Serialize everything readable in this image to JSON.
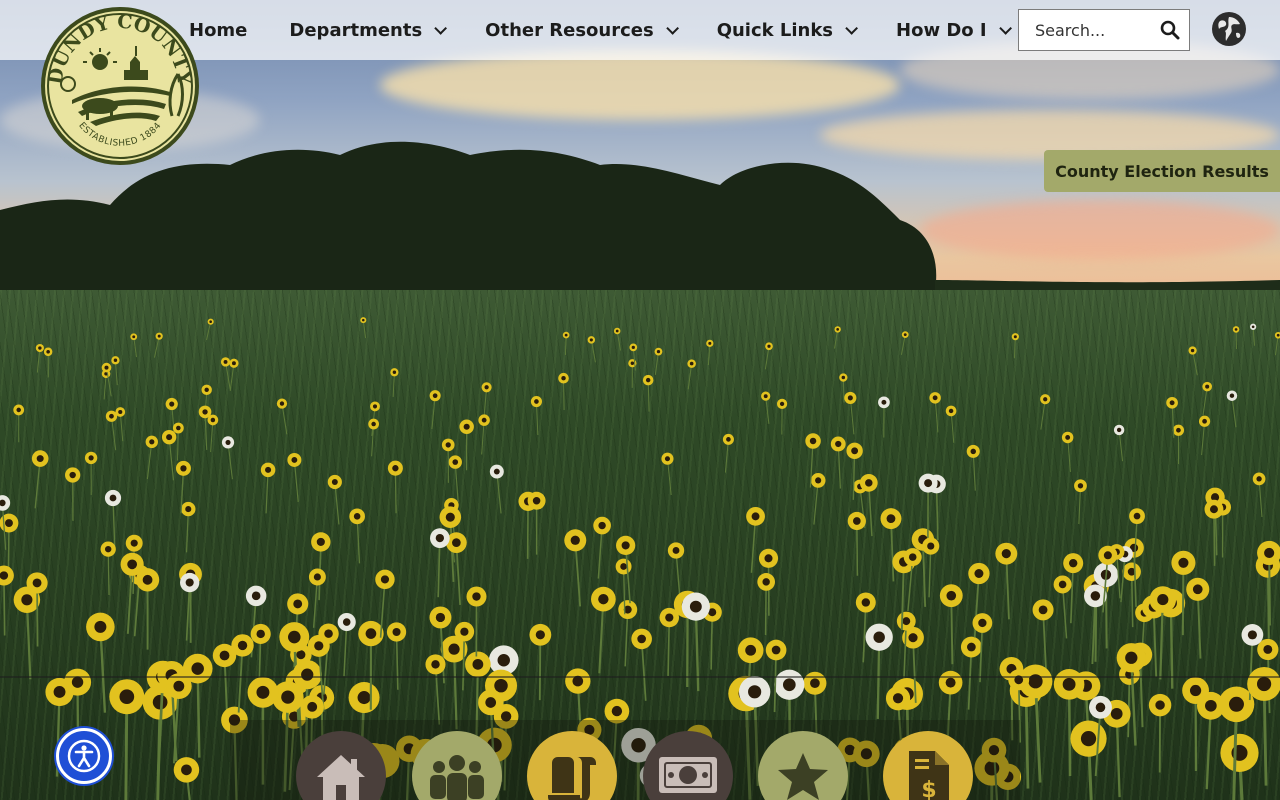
{
  "logo": {
    "name": "DUNDY COUNTY",
    "established": "ESTABLISHED 1884"
  },
  "nav": {
    "items": [
      {
        "label": "Home",
        "has_dropdown": false
      },
      {
        "label": "Departments",
        "has_dropdown": true
      },
      {
        "label": "Other Resources",
        "has_dropdown": true
      },
      {
        "label": "Quick Links",
        "has_dropdown": true
      },
      {
        "label": "How Do I",
        "has_dropdown": true
      }
    ]
  },
  "search": {
    "placeholder": "Search..."
  },
  "icons": {
    "search": "search-icon",
    "language": "globe-icon",
    "accessibility": "accessibility-icon"
  },
  "banner": {
    "election_label": "County Election Results"
  },
  "quick_icons": [
    {
      "name": "home-icon",
      "color": "#4a3f3b"
    },
    {
      "name": "people-icon",
      "color": "#a3a96a"
    },
    {
      "name": "scroll-icon",
      "color": "#d9b43a"
    },
    {
      "name": "money-icon",
      "color": "#4a3f3b"
    },
    {
      "name": "star-icon",
      "color": "#a3a96a"
    },
    {
      "name": "invoice-icon",
      "color": "#d9b43a"
    }
  ],
  "colors": {
    "olive": "#a3a96a",
    "gold": "#d9b43a",
    "brown": "#4a3f3b",
    "logo_green": "#3c4a1c",
    "logo_cream": "#e9e4a0",
    "a11y_blue": "#1f4fd6"
  }
}
